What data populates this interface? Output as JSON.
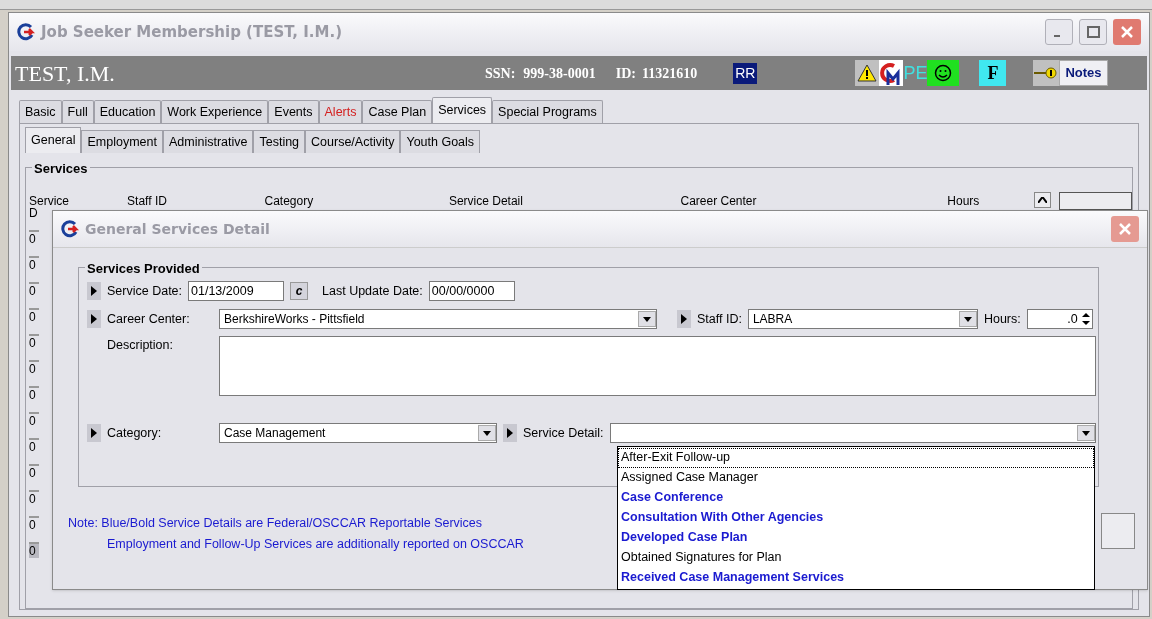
{
  "window": {
    "title": "Job Seeker Membership (TEST, I.M.)"
  },
  "header": {
    "name": "TEST, I.M.",
    "ssn_label": "SSN:",
    "ssn": "999-38-0001",
    "id_label": "ID:",
    "id": "11321610",
    "badge": "RR",
    "pe": "PE",
    "f": "F",
    "notes_button": "Notes"
  },
  "tabs": [
    {
      "label": "Basic",
      "selected": false,
      "color": "#000000"
    },
    {
      "label": "Full",
      "selected": false,
      "color": "#000000"
    },
    {
      "label": "Education",
      "selected": false,
      "color": "#000000"
    },
    {
      "label": "Work Experience",
      "selected": false,
      "color": "#000000"
    },
    {
      "label": "Events",
      "selected": false,
      "color": "#000000"
    },
    {
      "label": "Alerts",
      "selected": false,
      "color": "#d42020"
    },
    {
      "label": "Case Plan",
      "selected": false,
      "color": "#000000"
    },
    {
      "label": "Services",
      "selected": true,
      "color": "#000000"
    },
    {
      "label": "Special Programs",
      "selected": false,
      "color": "#000000"
    }
  ],
  "subtabs": [
    {
      "label": "General",
      "selected": true
    },
    {
      "label": "Employment",
      "selected": false
    },
    {
      "label": "Administrative",
      "selected": false
    },
    {
      "label": "Testing",
      "selected": false
    },
    {
      "label": "Course/Activity",
      "selected": false
    },
    {
      "label": "Youth Goals",
      "selected": false
    }
  ],
  "services": {
    "title": "Services",
    "columns": [
      "Service",
      "Staff ID",
      "Category",
      "Service Detail",
      "Career Center",
      "Hours"
    ],
    "column_1_line_2": "D",
    "rows": [
      {
        "cell": "0",
        "selected": false
      },
      {
        "cell": "0",
        "selected": false
      },
      {
        "cell": "0",
        "selected": false
      },
      {
        "cell": "0",
        "selected": false
      },
      {
        "cell": "0",
        "selected": false
      },
      {
        "cell": "0",
        "selected": false
      },
      {
        "cell": "0",
        "selected": false
      },
      {
        "cell": "0",
        "selected": false
      },
      {
        "cell": "0",
        "selected": false
      },
      {
        "cell": "0",
        "selected": false
      },
      {
        "cell": "0",
        "selected": false
      },
      {
        "cell": "0",
        "selected": false
      },
      {
        "cell": "0",
        "selected": true
      }
    ]
  },
  "dialog": {
    "title": "General Services Detail",
    "group_title": "Services Provided",
    "service_date_label": "Service Date:",
    "service_date": "01/13/2009",
    "calendar_button": "c",
    "last_update_label": "Last Update Date:",
    "last_update": "00/00/0000",
    "career_center_label": "Career Center:",
    "career_center": "BerkshireWorks - Pittsfield",
    "staff_id_label": "Staff ID:",
    "staff_id": "LABRA",
    "hours_label": "Hours:",
    "hours": ".0",
    "description_label": "Description:",
    "category_label": "Category:",
    "category": "Case Management",
    "service_detail_label": "Service Detail:",
    "note_lines": [
      "Note: Blue/Bold Service Details are Federal/OSCCAR Reportable Services",
      "Employment and Follow-Up Services are additionally reported on OSCCAR"
    ]
  },
  "service_detail_options": [
    {
      "label": "After-Exit Follow-up",
      "kind": "plain",
      "focused": true
    },
    {
      "label": "Assigned Case Manager",
      "kind": "plain",
      "focused": false
    },
    {
      "label": "Case Conference",
      "kind": "reportable",
      "focused": false
    },
    {
      "label": "Consultation With Other Agencies",
      "kind": "reportable",
      "focused": false
    },
    {
      "label": "Developed Case Plan",
      "kind": "reportable",
      "focused": false
    },
    {
      "label": "Obtained Signatures for Plan",
      "kind": "plain",
      "focused": false
    },
    {
      "label": "Received Case Management Services",
      "kind": "reportable",
      "focused": false
    }
  ]
}
